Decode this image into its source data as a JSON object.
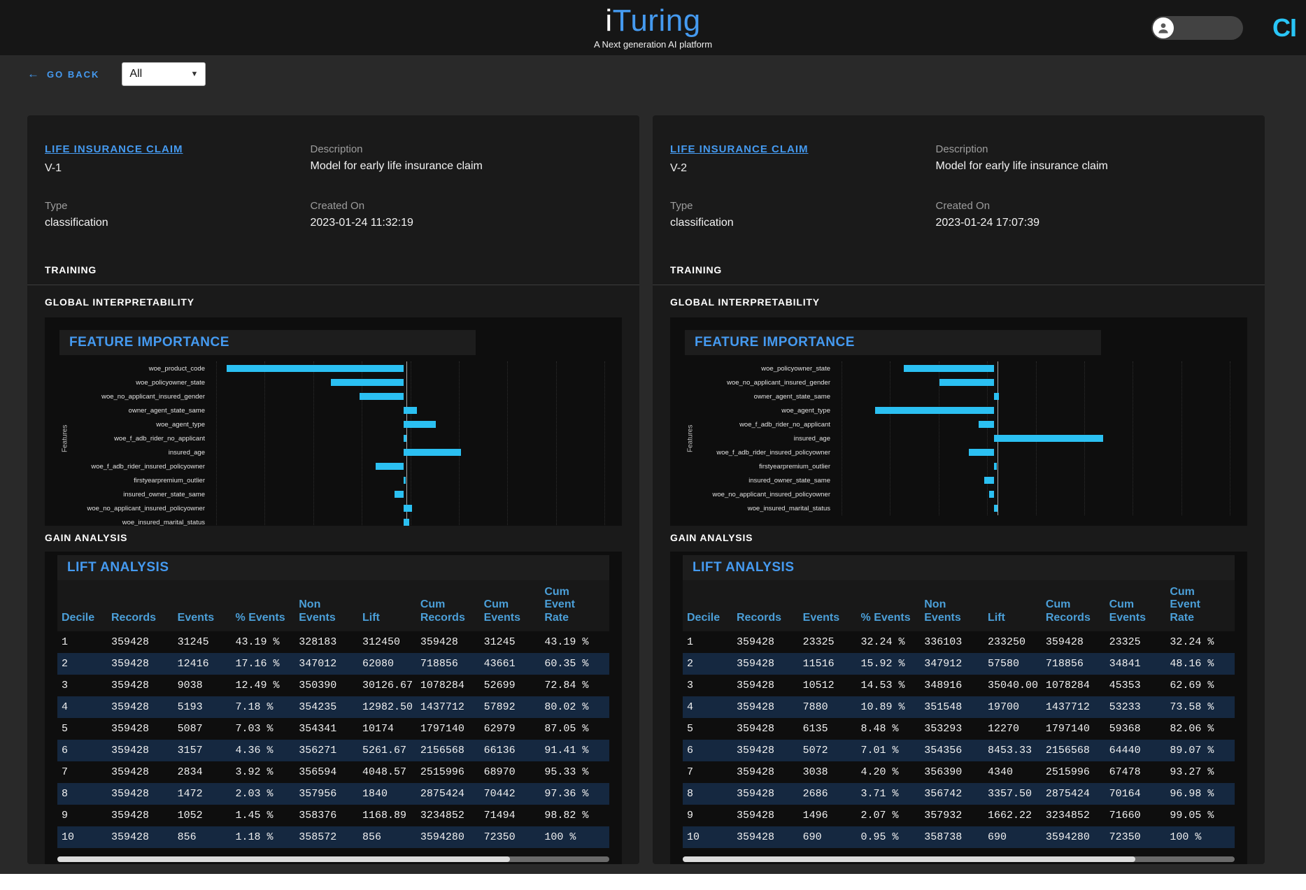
{
  "header": {
    "logo_prefix": "i",
    "logo_main": "Turing",
    "tagline": "A Next generation AI platform",
    "brand_logo": "CI"
  },
  "toolbar": {
    "go_back_label": "GO BACK",
    "back_arrow": "←",
    "filter_selected": "All",
    "caret": "▼"
  },
  "section_labels": {
    "description": "Description",
    "type": "Type",
    "created_on": "Created On",
    "training": "TRAINING",
    "global_interpretability": "GLOBAL INTERPRETABILITY",
    "gain_analysis": "GAIN ANALYSIS",
    "feature_importance_title": "FEATURE IMPORTANCE",
    "lift_analysis_title": "LIFT ANALYSIS",
    "features_axis_label": "Features"
  },
  "colors": {
    "accent_blue": "#459af0",
    "table_header_blue": "#4b9fd8",
    "bar_cyan": "#2bc0f2",
    "alt_row_navy": "#152840",
    "brand_cyan": "#29c5f6"
  },
  "models": [
    {
      "name": "LIFE INSURANCE CLAIM",
      "version": "V-1",
      "description": "Model for early life insurance claim",
      "type": "classification",
      "created_on": "2023-01-24 11:32:19",
      "chart_data": {
        "type": "bar",
        "orientation": "horizontal",
        "title": "FEATURE IMPORTANCE",
        "ylabel": "Features",
        "xlim": [
          -2.4,
          2.5
        ],
        "grid": true,
        "categories": [
          "woe_product_code",
          "woe_policyowner_state",
          "woe_no_applicant_insured_gender",
          "owner_agent_state_same",
          "woe_agent_type",
          "woe_f_adb_rider_no_applicant",
          "insured_age",
          "woe_f_adb_rider_insured_policyowner",
          "firstyearpremium_outlier",
          "insured_owner_state_same",
          "woe_no_applicant_insured_policyowner",
          "woe_insured_marital_status"
        ],
        "values": [
          -2.2,
          -0.9,
          -0.55,
          0.17,
          0.4,
          0.04,
          0.72,
          -0.35,
          0.03,
          -0.11,
          0.11,
          0.07
        ]
      },
      "lift_table": {
        "title": "LIFT ANALYSIS",
        "columns": [
          "Decile",
          "Records",
          "Events",
          "% Events",
          "Non\nEvents",
          "Lift",
          "Cum\nRecords",
          "Cum\nEvents",
          "Cum\nEvent\nRate"
        ],
        "rows": [
          [
            "1",
            "359428",
            "31245",
            "43.19 %",
            "328183",
            "312450",
            "359428",
            "31245",
            "43.19 %"
          ],
          [
            "2",
            "359428",
            "12416",
            "17.16 %",
            "347012",
            "62080",
            "718856",
            "43661",
            "60.35 %"
          ],
          [
            "3",
            "359428",
            "9038",
            "12.49 %",
            "350390",
            "30126.67",
            "1078284",
            "52699",
            "72.84 %"
          ],
          [
            "4",
            "359428",
            "5193",
            "7.18 %",
            "354235",
            "12982.50",
            "1437712",
            "57892",
            "80.02 %"
          ],
          [
            "5",
            "359428",
            "5087",
            "7.03 %",
            "354341",
            "10174",
            "1797140",
            "62979",
            "87.05 %"
          ],
          [
            "6",
            "359428",
            "3157",
            "4.36 %",
            "356271",
            "5261.67",
            "2156568",
            "66136",
            "91.41 %"
          ],
          [
            "7",
            "359428",
            "2834",
            "3.92 %",
            "356594",
            "4048.57",
            "2515996",
            "68970",
            "95.33 %"
          ],
          [
            "8",
            "359428",
            "1472",
            "2.03 %",
            "357956",
            "1840",
            "2875424",
            "70442",
            "97.36 %"
          ],
          [
            "9",
            "359428",
            "1052",
            "1.45 %",
            "358376",
            "1168.89",
            "3234852",
            "71494",
            "98.82 %"
          ],
          [
            "10",
            "359428",
            "856",
            "1.18 %",
            "358572",
            "856",
            "3594280",
            "72350",
            "100 %"
          ]
        ]
      }
    },
    {
      "name": "LIFE INSURANCE CLAIM",
      "version": "V-2",
      "description": "Model for early life insurance claim",
      "type": "classification",
      "created_on": "2023-01-24 17:07:39",
      "chart_data": {
        "type": "bar",
        "orientation": "horizontal",
        "title": "FEATURE IMPORTANCE",
        "ylabel": "Features",
        "xlim": [
          -1.85,
          2.75
        ],
        "grid": true,
        "categories": [
          "woe_policyowner_state",
          "woe_no_applicant_insured_gender",
          "owner_agent_state_same",
          "woe_agent_type",
          "woe_f_adb_rider_no_applicant",
          "insured_age",
          "woe_f_adb_rider_insured_policyowner",
          "firstyearpremium_outlier",
          "insured_owner_state_same",
          "woe_no_applicant_insured_policyowner",
          "woe_insured_marital_status"
        ],
        "values": [
          -1.06,
          -0.64,
          0.05,
          -1.39,
          -0.18,
          1.27,
          -0.3,
          0.03,
          -0.12,
          -0.06,
          0.04
        ]
      },
      "lift_table": {
        "title": "LIFT ANALYSIS",
        "columns": [
          "Decile",
          "Records",
          "Events",
          "% Events",
          "Non\nEvents",
          "Lift",
          "Cum\nRecords",
          "Cum\nEvents",
          "Cum\nEvent\nRate"
        ],
        "rows": [
          [
            "1",
            "359428",
            "23325",
            "32.24 %",
            "336103",
            "233250",
            "359428",
            "23325",
            "32.24 %"
          ],
          [
            "2",
            "359428",
            "11516",
            "15.92 %",
            "347912",
            "57580",
            "718856",
            "34841",
            "48.16 %"
          ],
          [
            "3",
            "359428",
            "10512",
            "14.53 %",
            "348916",
            "35040.00",
            "1078284",
            "45353",
            "62.69 %"
          ],
          [
            "4",
            "359428",
            "7880",
            "10.89 %",
            "351548",
            "19700",
            "1437712",
            "53233",
            "73.58 %"
          ],
          [
            "5",
            "359428",
            "6135",
            "8.48 %",
            "353293",
            "12270",
            "1797140",
            "59368",
            "82.06 %"
          ],
          [
            "6",
            "359428",
            "5072",
            "7.01 %",
            "354356",
            "8453.33",
            "2156568",
            "64440",
            "89.07 %"
          ],
          [
            "7",
            "359428",
            "3038",
            "4.20 %",
            "356390",
            "4340",
            "2515996",
            "67478",
            "93.27 %"
          ],
          [
            "8",
            "359428",
            "2686",
            "3.71 %",
            "356742",
            "3357.50",
            "2875424",
            "70164",
            "96.98 %"
          ],
          [
            "9",
            "359428",
            "1496",
            "2.07 %",
            "357932",
            "1662.22",
            "3234852",
            "71660",
            "99.05 %"
          ],
          [
            "10",
            "359428",
            "690",
            "0.95 %",
            "358738",
            "690",
            "3594280",
            "72350",
            "100 %"
          ]
        ]
      }
    }
  ]
}
